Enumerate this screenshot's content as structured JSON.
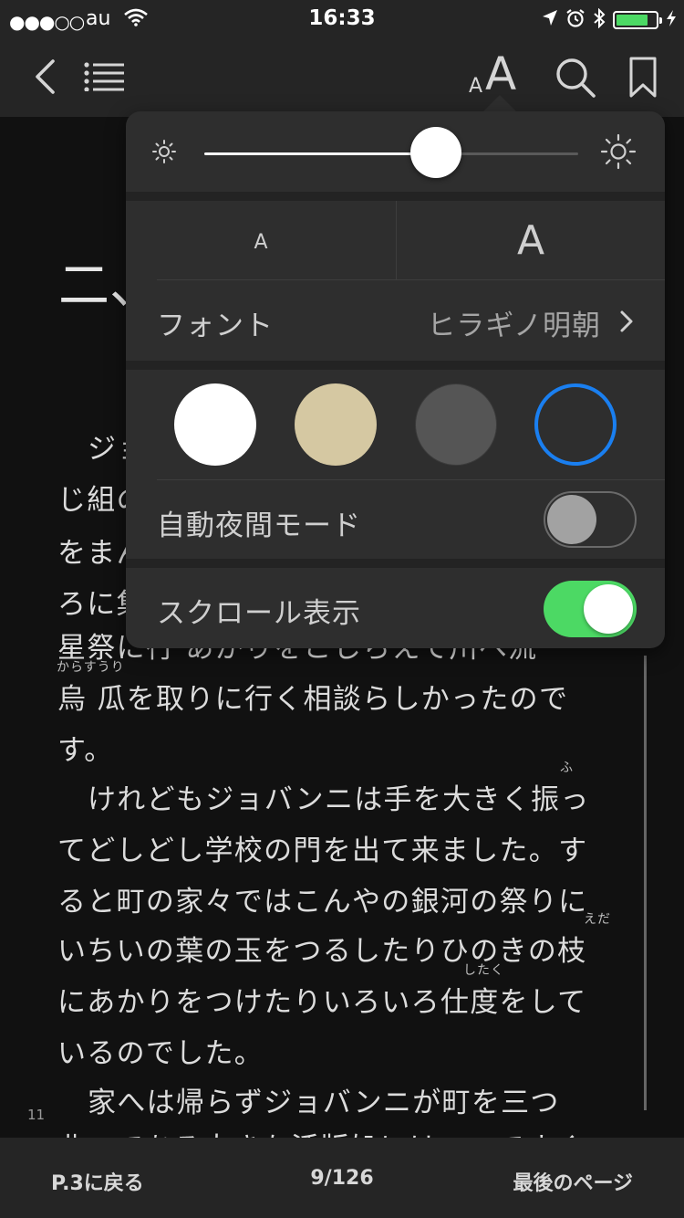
{
  "status_bar": {
    "signal": "●●●○○",
    "carrier": "au",
    "time": "16:33",
    "battery_level": 0.8
  },
  "nav": {
    "back_icon": "chevron-left-icon",
    "toc_icon": "list-icon",
    "text_size_small_glyph": "A",
    "text_size_large_glyph": "A",
    "search_icon": "search-icon",
    "bookmark_icon": "bookmark-icon"
  },
  "book": {
    "chapter_heading": "二、",
    "page_number": "11",
    "lines": [
      "ジョ",
      "じ組の",
      "をまん",
      "ろに集",
      "星祭に行 あかりをこしらえて川へ流",
      "烏 瓜を取りに行く相談らしかったので",
      "す。",
      "けれどもジョバンニは手を大きく振っ",
      "てどしどし学校の門を出て来ました。す",
      "ると町の家々ではこんやの銀河の祭りに",
      "いちいの葉の玉をつるしたりひのきの枝",
      "にあかりをつけたりいろいろ仕度をして",
      "いるのでした。",
      "家へは帰らずジョバンニが町を三つ",
      "曲ってある大きな活版処にはいってすぐ"
    ],
    "ruby": {
      "karasuuri": "からすうり",
      "fu": "ふ",
      "eda": "えだ",
      "shitaku": "したく"
    }
  },
  "settings": {
    "brightness_level": 0.62,
    "font_size_small_label": "A",
    "font_size_large_label": "A",
    "font_label": "フォント",
    "font_value": "ヒラギノ明朝",
    "themes": [
      {
        "name": "white",
        "color": "#ffffff",
        "selected": false
      },
      {
        "name": "sepia",
        "color": "#d5c8a2",
        "selected": false
      },
      {
        "name": "gray",
        "color": "#555555",
        "selected": false
      },
      {
        "name": "night",
        "color": "#2e2e2e",
        "selected": true
      }
    ],
    "accent_color": "#1a7ff0",
    "auto_night_label": "自動夜間モード",
    "auto_night_on": false,
    "scroll_label": "スクロール表示",
    "scroll_on": true,
    "toggle_on_color": "#4cd964"
  },
  "bottom_bar": {
    "back_label": "P.3に戻る",
    "page_indicator": "9/126",
    "last_page_label": "最後のページ"
  }
}
